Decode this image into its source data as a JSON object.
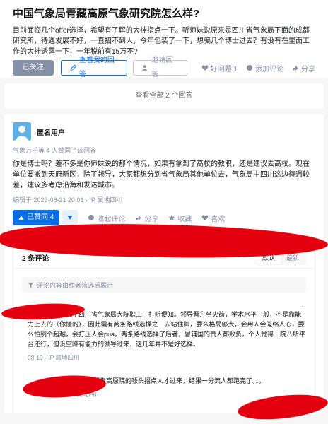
{
  "question": {
    "title": "中国气象局青藏高原气象研究院怎么样?",
    "description": "目前面临几个offer选择，希望有了解的大神指点一下。听师妹说原来是四川省气象局下面的成都研究所，待遇发展不好，一直招不到人，今年包装了一下，想骗几个博士过去？有没有在里面工作的大神透露一下，一年税前有15万不?",
    "followed_label": "已关注",
    "view_my_answer_label": "查看我的回答",
    "invite_label": "邀请回答",
    "good_question_label": "好问题 1",
    "add_comment_label": "添加评论",
    "share_label": "分享"
  },
  "view_all_label": "查看全部 2 个回答",
  "answer": {
    "author": "匿名用户",
    "agree_line": "气象万千等 4 人赞同了该回答",
    "text": "你是博士吗？差不多是你师妹说的那个情况，如果有拿到了高校的教职，还是建议去高校。现在单位要搬到天府新区，除了领导，大家都想分到省气象局其他单位去，气象局中四川这边待遇较差，建议多考虑沿海和发达城市。",
    "edit_info": "编辑于 2023-06-21 20:01 · IP 属地四川",
    "vote_label": "已赞同 4",
    "collapse_comments_label": "收起评论",
    "share_label": "分享",
    "favorite_label": "收藏",
    "like_label": "喜欢"
  },
  "comments": {
    "count_label": "2 条评论",
    "sort_default": "默认",
    "sort_latest": "最新",
    "filter_placeholder": "评论内容由作者筛选后展示",
    "items": [
      {
        "text": "气象圈子小，我个四川省气象局大院职工一打听便知。领导晋升坐火箭，学术水平一般，不是靠能力上去的（你懂的），因此需有两条路线选择之一去站住脚，要么格局够大，会用人会笼络人心，要么怕别个超越，会打压人会pua。两条路线选择了后者，冒辅国的贵人都败负，个人觉得一院八所平台还行，但没空降有能力的领导过来，这几年并不是好选择。",
        "meta": "08-19 · IP 属地四川"
      },
      {
        "text": "留不住人呀，本想靠高原院的噱头招点人才过来，结果一分流人都跑完了。。。",
        "meta": "08-19 · IP 属地四川"
      }
    ]
  },
  "colors": {
    "brand": "#056de8",
    "redaction": "#e4000f"
  }
}
